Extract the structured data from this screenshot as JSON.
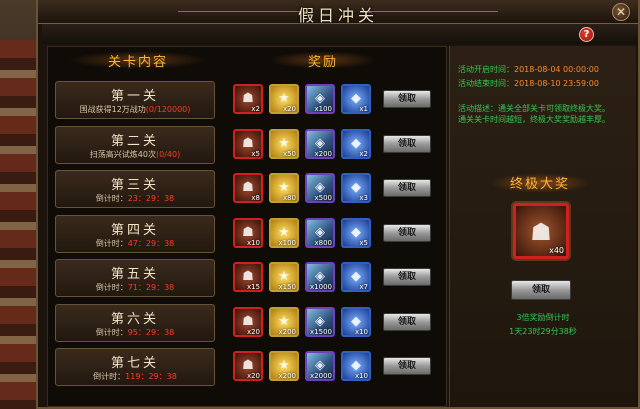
{
  "window": {
    "title": "假日冲关",
    "close_glyph": "✕",
    "help_glyph": "?"
  },
  "columns": {
    "stage": "关卡内容",
    "reward": "奖励"
  },
  "claim_label": "领取",
  "stages": [
    {
      "name": "第一关",
      "desc": "国战获得12万战功",
      "progress": "(0/120000)",
      "rewards": [
        {
          "icon": "portrait-item-icon",
          "qty": "x2"
        },
        {
          "icon": "gold-coin-icon",
          "qty": "x20"
        },
        {
          "icon": "mirror-item-icon",
          "qty": "x100"
        },
        {
          "icon": "crystal-icon",
          "qty": "x1"
        }
      ]
    },
    {
      "name": "第二关",
      "desc": "扫荡高兴试炼40次",
      "progress": "(0/40)",
      "rewards": [
        {
          "icon": "portrait-item-icon",
          "qty": "x5"
        },
        {
          "icon": "gold-coin-icon",
          "qty": "x50"
        },
        {
          "icon": "mirror-item-icon",
          "qty": "x200"
        },
        {
          "icon": "crystal-icon",
          "qty": "x2"
        }
      ]
    },
    {
      "name": "第三关",
      "desc": "倒计时：",
      "progress": "23：29：38",
      "rewards": [
        {
          "icon": "portrait-item-icon",
          "qty": "x8"
        },
        {
          "icon": "gold-coin-icon",
          "qty": "x80"
        },
        {
          "icon": "mirror-item-icon",
          "qty": "x500"
        },
        {
          "icon": "crystal-icon",
          "qty": "x3"
        }
      ]
    },
    {
      "name": "第四关",
      "desc": "倒计时：",
      "progress": "47：29：38",
      "rewards": [
        {
          "icon": "portrait-item-icon",
          "qty": "x10"
        },
        {
          "icon": "gold-coin-icon",
          "qty": "x100"
        },
        {
          "icon": "mirror-item-icon",
          "qty": "x800"
        },
        {
          "icon": "crystal-icon",
          "qty": "x5"
        }
      ]
    },
    {
      "name": "第五关",
      "desc": "倒计时：",
      "progress": "71：29：38",
      "rewards": [
        {
          "icon": "portrait-item-icon",
          "qty": "x15"
        },
        {
          "icon": "gold-coin-icon",
          "qty": "x150"
        },
        {
          "icon": "mirror-item-icon",
          "qty": "x1000"
        },
        {
          "icon": "crystal-icon",
          "qty": "x7"
        }
      ]
    },
    {
      "name": "第六关",
      "desc": "倒计时：",
      "progress": "95：29：38",
      "rewards": [
        {
          "icon": "portrait-item-icon",
          "qty": "x20"
        },
        {
          "icon": "gold-coin-icon",
          "qty": "x200"
        },
        {
          "icon": "mirror-item-icon",
          "qty": "x1500"
        },
        {
          "icon": "crystal-icon",
          "qty": "x10"
        }
      ]
    },
    {
      "name": "第七关",
      "desc": "倒计时：",
      "progress": "119：29：38",
      "rewards": [
        {
          "icon": "portrait-item-icon",
          "qty": "x20"
        },
        {
          "icon": "gold-coin-icon",
          "qty": "x200"
        },
        {
          "icon": "mirror-item-icon",
          "qty": "x2000"
        },
        {
          "icon": "crystal-icon",
          "qty": "x10"
        }
      ]
    }
  ],
  "event": {
    "start_label": "活动开启时间：",
    "start_value": "2018-08-04 00:00:00",
    "end_label": "活动结束时间：",
    "end_value": "2018-08-10 23:59:00",
    "desc_line1": "活动描述：通关全部关卡可领取终极大奖。",
    "desc_line2": "通关关卡时间越短，终极大奖奖励越丰厚。"
  },
  "grand": {
    "title": "终极大奖",
    "qty": "x40",
    "claim_label": "领取",
    "countdown_label": "3倍奖励倒计时",
    "countdown_value": "1天23时29分38秒"
  },
  "colors": {
    "accent": "#ffb638",
    "green": "#34c854",
    "red": "#ff3a2a"
  }
}
